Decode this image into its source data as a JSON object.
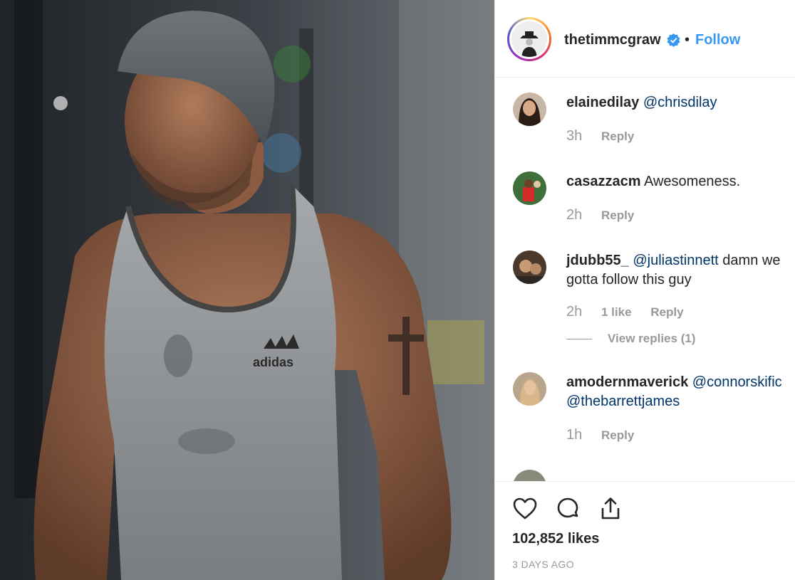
{
  "post": {
    "photo_alt_icon": "post-photo",
    "shirt_brand": "adidas"
  },
  "header": {
    "username": "thetimmcgraw",
    "separator": "•",
    "follow_label": "Follow",
    "verified_icon": "verified-badge-icon"
  },
  "comments": [
    {
      "user": "elainedilay",
      "text_parts": [
        {
          "mention": "@chrisdilay"
        }
      ],
      "time": "3h",
      "likes": "",
      "reply": "Reply"
    },
    {
      "user": "casazzacm",
      "text_parts": [
        {
          "text": "Awesomeness."
        }
      ],
      "time": "2h",
      "likes": "",
      "reply": "Reply"
    },
    {
      "user": "jdubb55_",
      "text_parts": [
        {
          "mention": "@juliastinnett"
        },
        {
          "text": " damn we gotta follow this guy"
        }
      ],
      "time": "2h",
      "likes": "1 like",
      "reply": "Reply",
      "view_replies": "View replies (1)"
    },
    {
      "user": "amodernmaverick",
      "text_parts": [
        {
          "mention": "@connorskific"
        },
        {
          "text": " "
        },
        {
          "mention": "@thebarrettjames"
        }
      ],
      "time": "1h",
      "likes": "",
      "reply": "Reply"
    }
  ],
  "comment0": {
    "user": "elainedilay",
    "mention": "@chrisdilay",
    "time": "3h",
    "reply": "Reply"
  },
  "comment1": {
    "user": "casazzacm",
    "text": "Awesomeness.",
    "time": "2h",
    "reply": "Reply"
  },
  "comment2": {
    "user": "jdubb55_",
    "mention": "@juliastinnett",
    "text": " damn we gotta follow this guy",
    "time": "2h",
    "likes": "1 like",
    "reply": "Reply",
    "view_replies": "View replies (1)"
  },
  "comment3": {
    "user": "amodernmaverick",
    "mention1": "@connorskific",
    "mention2": "@thebarrettjames",
    "time": "1h",
    "reply": "Reply"
  },
  "footer": {
    "icons": [
      "heart-icon",
      "comment-icon",
      "share-icon"
    ],
    "likes": "102,852 likes",
    "date": "3 DAYS AGO"
  },
  "colors": {
    "link_blue": "#3897f0",
    "mention_blue": "#003569",
    "muted_gray": "#999999",
    "text_dark": "#262626"
  }
}
